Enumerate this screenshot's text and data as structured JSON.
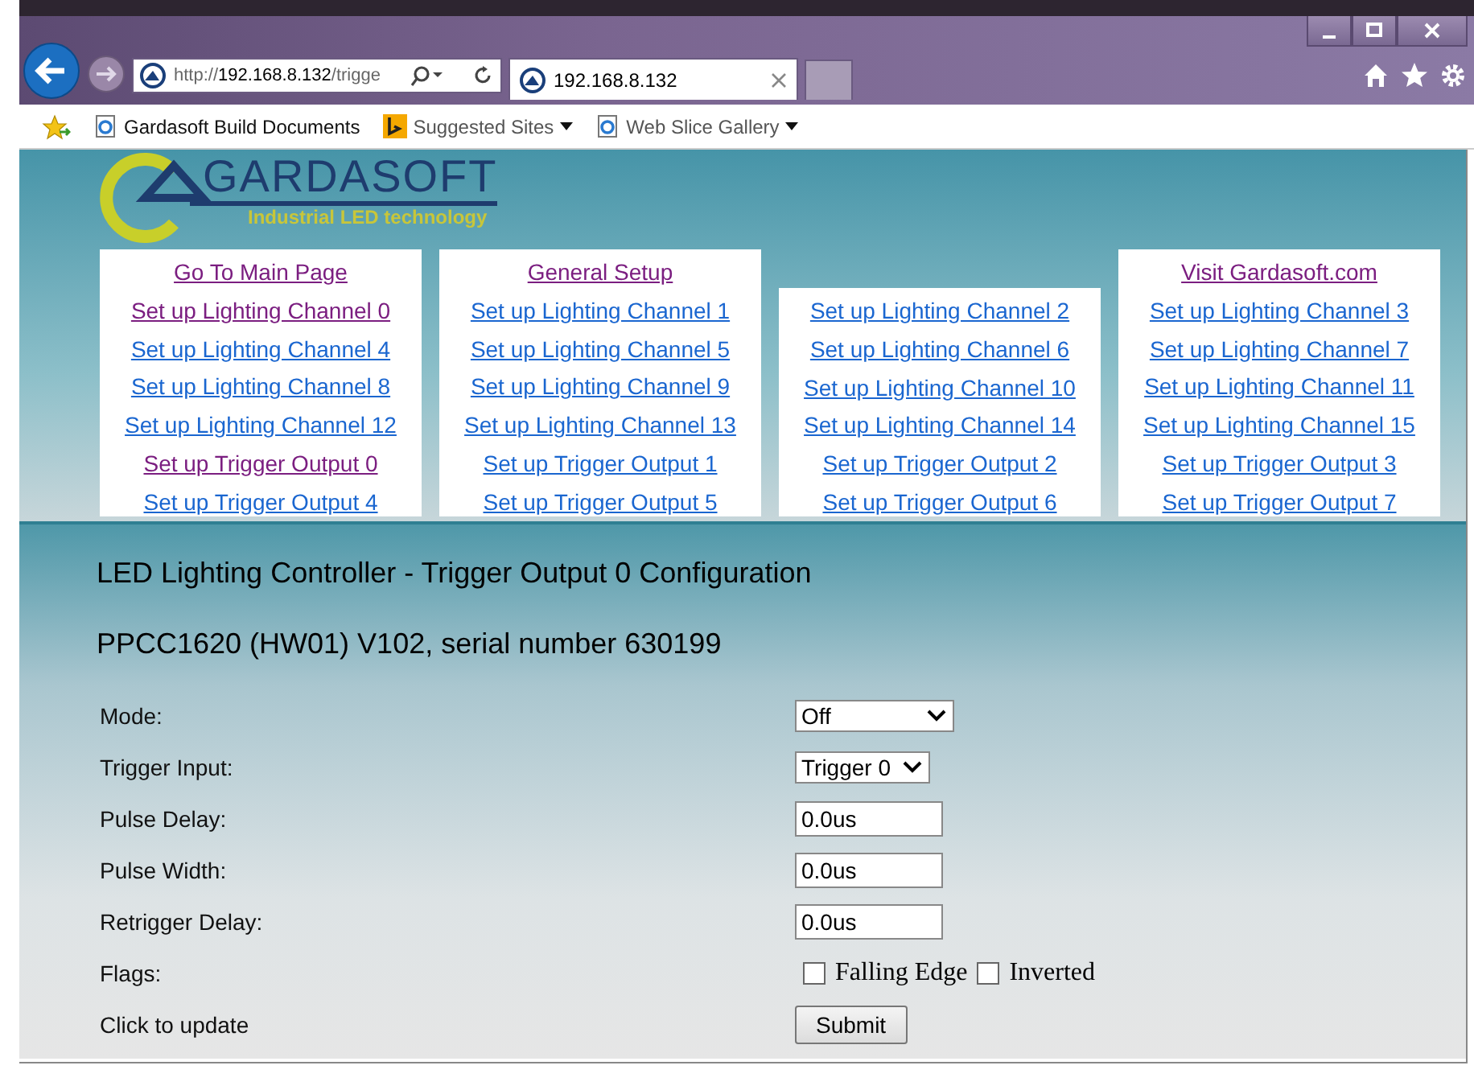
{
  "browser": {
    "address": {
      "scheme": "http://",
      "host": "192.168.8.132",
      "path": "/trigge"
    },
    "tab": {
      "title": "192.168.8.132",
      "selected": true
    },
    "favorites": [
      {
        "label": "Gardasoft Build Documents",
        "kind": "page"
      },
      {
        "label": "Suggested Sites",
        "kind": "bing"
      },
      {
        "label": "Web Slice Gallery",
        "kind": "page"
      }
    ]
  },
  "logo": {
    "name": "GARDASOFT",
    "tagline": "Industrial LED technology"
  },
  "nav_columns": [
    {
      "header": {
        "label": "Go To Main Page",
        "visited": true
      },
      "links": [
        {
          "label": "Set up Lighting Channel 0",
          "visited": true
        },
        {
          "label": "Set up Lighting Channel 4",
          "visited": false
        },
        {
          "label": "Set up Lighting Channel 8",
          "visited": false
        },
        {
          "label": "Set up Lighting Channel 12",
          "visited": false
        },
        {
          "label": "Set up Trigger Output 0",
          "visited": true
        },
        {
          "label": "Set up Trigger Output 4",
          "visited": false
        }
      ]
    },
    {
      "header": {
        "label": "General Setup",
        "visited": true
      },
      "links": [
        {
          "label": "Set up Lighting Channel 1",
          "visited": false
        },
        {
          "label": "Set up Lighting Channel 5",
          "visited": false
        },
        {
          "label": "Set up Lighting Channel 9",
          "visited": false
        },
        {
          "label": "Set up Lighting Channel 13",
          "visited": false
        },
        {
          "label": "Set up Trigger Output 1",
          "visited": false
        },
        {
          "label": "Set up Trigger Output 5",
          "visited": false
        }
      ]
    },
    {
      "links": [
        {
          "label": "Set up Lighting Channel 2",
          "visited": false
        },
        {
          "label": "Set up Lighting Channel 6",
          "visited": false
        },
        {
          "label": "Set up Lighting Channel 10",
          "visited": false
        },
        {
          "label": "Set up Lighting Channel 14",
          "visited": false
        },
        {
          "label": "Set up Trigger Output 2",
          "visited": false
        },
        {
          "label": "Set up Trigger Output 6",
          "visited": false
        }
      ]
    },
    {
      "header": {
        "label": "Visit Gardasoft.com",
        "visited": true
      },
      "links": [
        {
          "label": "Set up Lighting Channel 3",
          "visited": false
        },
        {
          "label": "Set up Lighting Channel 7",
          "visited": false
        },
        {
          "label": "Set up Lighting Channel 11",
          "visited": false
        },
        {
          "label": "Set up Lighting Channel 15",
          "visited": false
        },
        {
          "label": "Set up Trigger Output 3",
          "visited": false
        },
        {
          "label": "Set up Trigger Output 7",
          "visited": false
        }
      ]
    }
  ],
  "title": "LED Lighting Controller - Trigger Output 0 Configuration",
  "device": "PPCC1620 (HW01) V102, serial number 630199",
  "form": [
    {
      "label": "Mode:",
      "kind": "select",
      "value": "Off",
      "wide": true
    },
    {
      "label": "Trigger Input:",
      "kind": "select",
      "value": "Trigger 0",
      "wide": false
    },
    {
      "label": "Pulse Delay:",
      "kind": "input",
      "value": "0.0us"
    },
    {
      "label": "Pulse Width:",
      "kind": "input",
      "value": "0.0us"
    },
    {
      "label": "Retrigger Delay:",
      "kind": "input",
      "value": "0.0us"
    },
    {
      "label": "Flags:",
      "kind": "checks",
      "options": [
        {
          "label": "Falling Edge",
          "checked": false
        },
        {
          "label": "Inverted",
          "checked": false
        }
      ]
    },
    {
      "label": "Click to update",
      "kind": "button",
      "value": "Submit"
    }
  ]
}
